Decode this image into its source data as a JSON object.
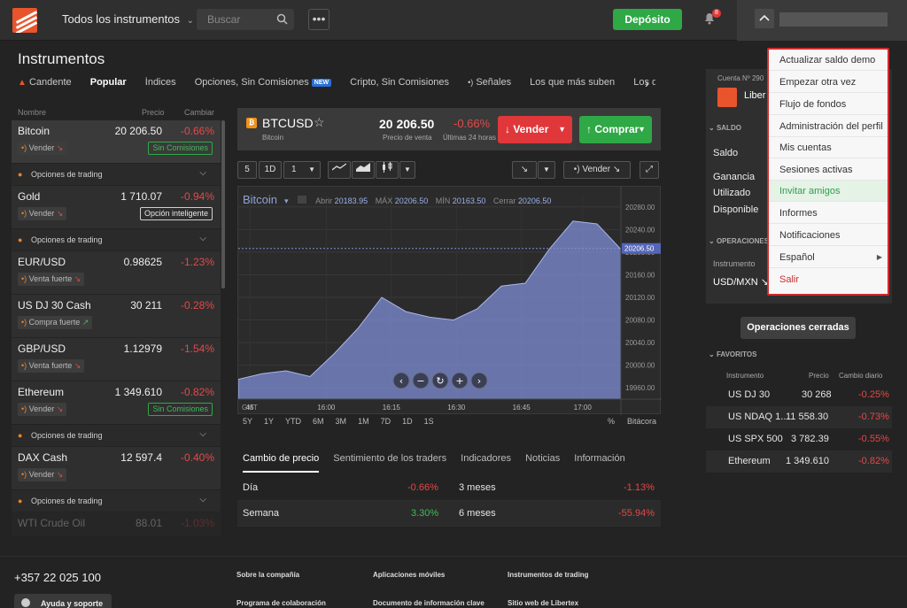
{
  "topbar": {
    "instruments_select": "Todos los instrumentos",
    "search_placeholder": "Buscar",
    "more_label": "•••",
    "deposit_label": "Depósito",
    "notification_count": "8"
  },
  "page_title": "Instrumentos",
  "category_tabs": [
    {
      "label": "Candente",
      "icon": "fire-icon"
    },
    {
      "label": "Popular",
      "active": true
    },
    {
      "label": "Índices"
    },
    {
      "label": "Opciones, Sin Comisiones",
      "badge": "NEW"
    },
    {
      "label": "Cripto, Sin Comisiones"
    },
    {
      "label": "Señales",
      "icon": "signal-icon"
    },
    {
      "label": "Los que más suben"
    },
    {
      "label": "Los que más"
    }
  ],
  "list_headers": {
    "name": "Nombre",
    "price": "Precio",
    "change": "Cambiar"
  },
  "instruments": [
    {
      "name": "Bitcoin",
      "price": "20 206.50",
      "change": "-0.66%",
      "signal": "Vender",
      "tag": "Sin Comisiones",
      "tag_kind": "green",
      "options": "Opciones de trading",
      "selected": true
    },
    {
      "name": "Gold",
      "price": "1 710.07",
      "change": "-0.94%",
      "signal": "Vender",
      "tag": "Opción inteligente",
      "tag_kind": "smart",
      "options": "Opciones de trading"
    },
    {
      "name": "EUR/USD",
      "price": "0.98625",
      "change": "-1.23%",
      "signal": "Venta fuerte"
    },
    {
      "name": "US DJ 30 Cash",
      "price": "30 211",
      "change": "-0.28%",
      "signal": "Compra fuerte"
    },
    {
      "name": "GBP/USD",
      "price": "1.12979",
      "change": "-1.54%",
      "signal": "Venta fuerte"
    },
    {
      "name": "Ethereum",
      "price": "1 349.610",
      "change": "-0.82%",
      "signal": "Vender",
      "tag": "Sin Comisiones",
      "tag_kind": "green",
      "options": "Opciones de trading"
    },
    {
      "name": "DAX Cash",
      "price": "12 597.4",
      "change": "-0.40%",
      "signal": "Vender",
      "options": "Opciones de trading"
    },
    {
      "name": "WTI Crude Oil",
      "price": "88.01",
      "change": "-1.03%"
    }
  ],
  "detail": {
    "symbol": "BTCUSD",
    "name": "Bitcoin",
    "sell_price": "20 206.50",
    "sell_price_label": "Precio de venta",
    "change_24h": "-0.66%",
    "change_24h_label": "Últimas 24 horas",
    "sell_label": "Vender",
    "buy_label": "Comprar"
  },
  "toolbar": {
    "btn_5": "5",
    "btn_1d": "1D",
    "btn_1": "1",
    "signal_label": "Vender"
  },
  "chart_info": {
    "instrument": "Bitcoin",
    "open_label": "Abrir",
    "open": "20183.95",
    "max_label": "MÁX",
    "max": "20206.50",
    "min_label": "MÍN",
    "min": "20163.50",
    "close_label": "Cerrar",
    "close": "20206.50",
    "current_price_tag": "20206.50"
  },
  "chart_data": {
    "type": "area",
    "x_tick_labels": [
      "45",
      "16:00",
      "16:15",
      "16:30",
      "16:45",
      "17:00"
    ],
    "y_tick_labels": [
      "20280.00",
      "20240.00",
      "20200.00",
      "20160.00",
      "20120.00",
      "20080.00",
      "20040.00",
      "20000.00",
      "19960.00"
    ],
    "ylim": [
      19940,
      20300
    ],
    "timezone_label": "GMT",
    "x": [
      "15:45",
      "15:50",
      "15:55",
      "16:00",
      "16:05",
      "16:10",
      "16:15",
      "16:20",
      "16:25",
      "16:30",
      "16:35",
      "16:40",
      "16:45",
      "16:50",
      "16:55",
      "17:00",
      "17:03"
    ],
    "values": [
      19975,
      19985,
      19990,
      19980,
      20020,
      20065,
      20120,
      20095,
      20085,
      20080,
      20100,
      20140,
      20145,
      20205,
      20255,
      20250,
      20205
    ],
    "color": "#7f8fd6"
  },
  "periods": [
    "5Y",
    "1Y",
    "YTD",
    "6M",
    "3M",
    "1M",
    "7D",
    "1D",
    "1S"
  ],
  "periods_right": {
    "pct": "%",
    "log": "Bitácora"
  },
  "detail_tabs": [
    "Cambio de precio",
    "Sentimiento de los traders",
    "Indicadores",
    "Noticias",
    "Información"
  ],
  "perf": [
    {
      "l1": "Día",
      "v1": "-0.66%",
      "l2": "3 meses",
      "v2": "-1.13%"
    },
    {
      "l1": "Semana",
      "v1": "3.30%",
      "l2": "6 meses",
      "v2": "-55.94%"
    }
  ],
  "account": {
    "label": "Cuenta Nº 290",
    "name": "Liber",
    "saldo_section": "SALDO",
    "rows": [
      "Saldo",
      "Ganancia",
      "Utilizado",
      "Disponible"
    ],
    "ops_section": "OPERACIONES",
    "ops_col": "Instrumento",
    "ops_instrument": "USD/MXN"
  },
  "closed_ops_label": "Operaciones cerradas",
  "favorites": {
    "section": "FAVORITOS",
    "headers": [
      "Instrumento",
      "Precio",
      "Cambio diario"
    ],
    "rows": [
      {
        "name": "US DJ 30",
        "price": "30 268",
        "change": "-0.25%"
      },
      {
        "name": "US NDAQ 1...",
        "price": "11 558.30",
        "change": "-0.73%"
      },
      {
        "name": "US SPX 500",
        "price": "3 782.39",
        "change": "-0.55%"
      },
      {
        "name": "Ethereum",
        "price": "1 349.610",
        "change": "-0.82%"
      }
    ]
  },
  "user_menu": [
    "Actualizar saldo demo",
    "Empezar otra vez",
    "Flujo de fondos",
    "Administración del perfil",
    "Mis cuentas",
    "Sesiones activas",
    "Invitar amigos",
    "Informes",
    "Notificaciones",
    "Español",
    "Salir"
  ],
  "footer": {
    "phone": "+357 22 025 100",
    "help": "Ayuda y soporte",
    "links": [
      "Sobre la compañía",
      "Aplicaciones móviles",
      "Instrumentos de trading",
      "Programa de colaboración",
      "Documento de información clave",
      "Sitio web de Libertex"
    ]
  }
}
